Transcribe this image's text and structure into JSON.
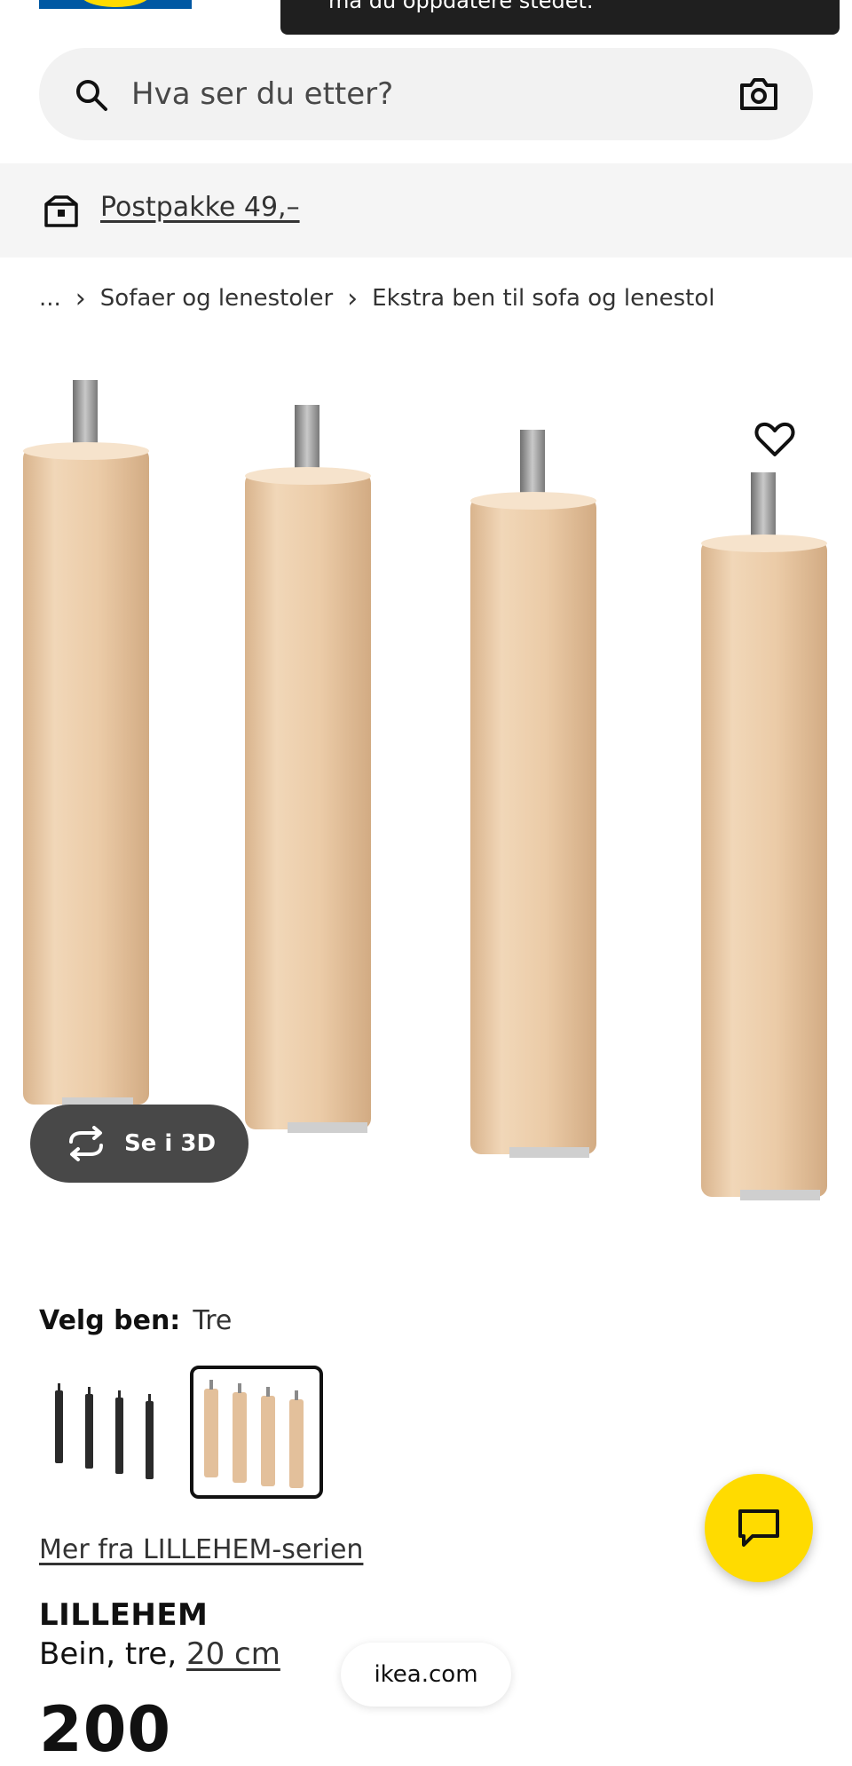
{
  "header": {
    "logo_icon": "ikea-logo",
    "toast_text": "må du oppdatere stedet."
  },
  "search": {
    "placeholder": "Hva ser du etter?",
    "icon": "search-icon",
    "camera_icon": "camera-icon"
  },
  "delivery": {
    "icon": "store-box-icon",
    "link": "Postpakke 49,–"
  },
  "breadcrumb": {
    "ellipsis": "...",
    "items": [
      "Sofaer og lenestoler",
      "Ekstra ben til sofa og lenestol"
    ]
  },
  "gallery": {
    "wishlist_icon": "heart-icon",
    "view3d_label": "Se i 3D",
    "view3d_icon": "rotate-3d-icon"
  },
  "variant": {
    "label": "Velg ben:",
    "value": "Tre",
    "options": [
      "black-legs",
      "wood-legs"
    ],
    "selected_index": 1
  },
  "chat": {
    "icon": "chat-icon"
  },
  "product": {
    "series_link": "Mer fra LILLEHEM-serien",
    "name": "LILLEHEM",
    "desc": "Bein, tre,",
    "size": "20 cm",
    "price": "200"
  },
  "browser": {
    "domain": "ikea.com"
  },
  "colors": {
    "brand_blue": "#0058a3",
    "brand_yellow": "#ffdb00",
    "wood": "#e8c9a6",
    "dark_button": "#484848"
  }
}
